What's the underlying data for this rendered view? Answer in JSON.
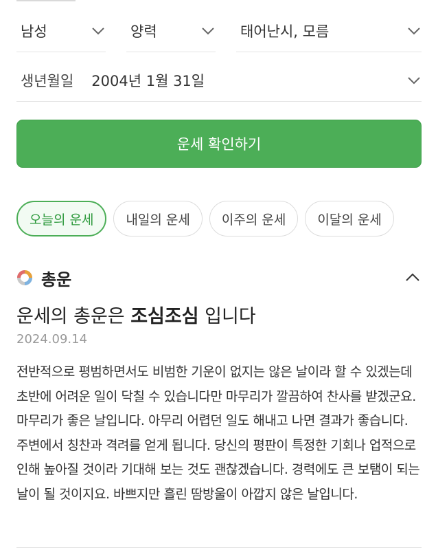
{
  "selects": {
    "gender": "남성",
    "calendar": "양력",
    "birth_time": "태어난시, 모름"
  },
  "birth": {
    "label": "생년월일",
    "date": "2004년 1월 31일"
  },
  "confirm_label": "운세 확인하기",
  "tabs": [
    {
      "label": "오늘의 운세",
      "active": true
    },
    {
      "label": "내일의 운세",
      "active": false
    },
    {
      "label": "이주의 운세",
      "active": false
    },
    {
      "label": "이달의 운세",
      "active": false
    }
  ],
  "section": {
    "title": "총운",
    "icon": "donut-chart-icon",
    "headline_prefix": "운세의 총운은 ",
    "headline_emphasis": "조심조심",
    "headline_suffix": " 입니다",
    "date": "2024.09.14",
    "body": "전반적으로 평범하면서도 비범한 기운이 없지는 않은 날이라 할 수 있겠는데 초반에 어려운 일이 닥칠 수 있습니다만 마무리가 깔끔하여 찬사를 받겠군요. 마무리가 좋은 날입니다. 아무리 어렵던 일도 해내고 나면 결과가 좋습니다. 주변에서 칭찬과 격려를 얻게 됩니다. 당신의 평판이 특정한 기회나 업적으로 인해 높아질 것이라 기대해 보는 것도 괜찮겠습니다. 경력에도 큰 보탬이 되는 날이 될 것이지요. 바쁘지만 흘린 땀방울이 아깝지 않은 날입니다."
  },
  "colors": {
    "accent_green": "#4cae57",
    "donut": [
      "#e8a13a",
      "#7fb3e0",
      "#c9c9c9",
      "#e06b6b"
    ]
  }
}
